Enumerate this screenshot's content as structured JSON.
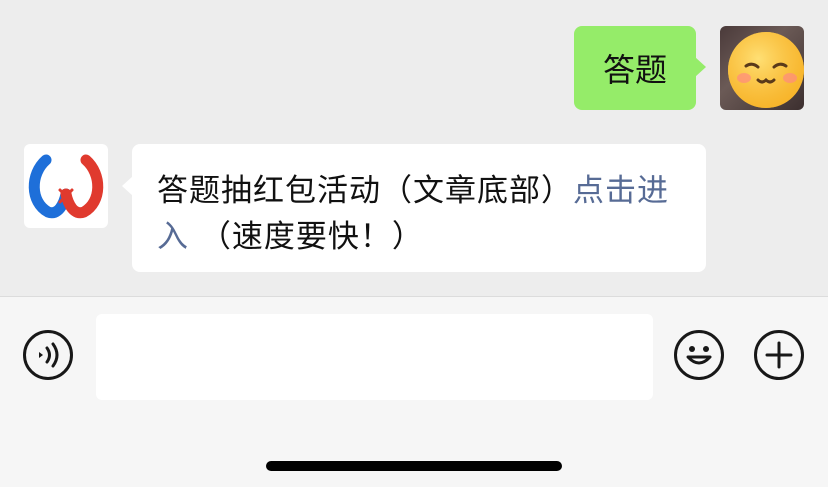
{
  "messages": [
    {
      "sender": "me",
      "text": "答题",
      "avatar_icon": "smiley-face-avatar"
    },
    {
      "sender": "bot",
      "avatar_icon": "w-logo-avatar",
      "text_before": "答题抽红包活动（文章底部）",
      "link_text": "点击进入",
      "text_after": "（速度要快！）",
      "link_color": "#576b95"
    }
  ],
  "input_bar": {
    "placeholder": "",
    "voice_icon": "voice-icon",
    "emoji_icon": "emoji-icon",
    "plus_icon": "plus-icon"
  },
  "colors": {
    "outgoing_bubble": "#95ec69",
    "incoming_bubble": "#ffffff",
    "chat_background": "#ededed",
    "input_background": "#f6f6f6"
  }
}
